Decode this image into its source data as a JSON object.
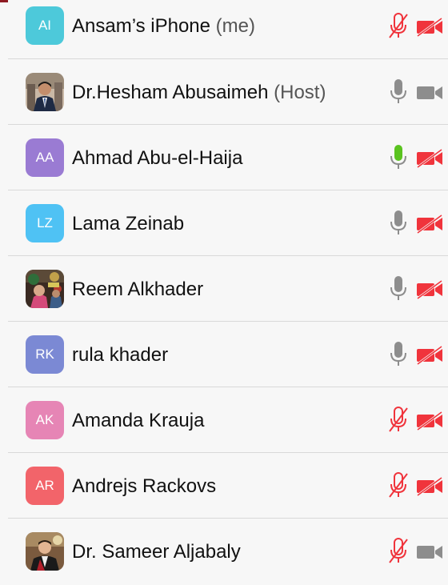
{
  "colors": {
    "muted_red": "#f0343c",
    "icon_gray": "#8d8d8d",
    "active_green": "#5ac31f"
  },
  "participants": [
    {
      "initials": "AI",
      "name": "Ansam’s iPhone",
      "tag": "(me)",
      "avatar_color": "#4dc9da",
      "mic": "muted",
      "video": "off"
    },
    {
      "initials": "",
      "name": "Dr.Hesham Abusaimeh",
      "tag": "(Host)",
      "avatar_color": "photo",
      "mic": "on",
      "video": "on"
    },
    {
      "initials": "AA",
      "name": "Ahmad Abu-el-Haija",
      "tag": "",
      "avatar_color": "#9a7bd3",
      "mic": "speaking",
      "video": "off"
    },
    {
      "initials": "LZ",
      "name": "Lama Zeinab",
      "tag": "",
      "avatar_color": "#4fc2f4",
      "mic": "on",
      "video": "off"
    },
    {
      "initials": "",
      "name": "Reem Alkhader",
      "tag": "",
      "avatar_color": "photo",
      "mic": "on",
      "video": "off"
    },
    {
      "initials": "RK",
      "name": "rula khader",
      "tag": "",
      "avatar_color": "#7b89d4",
      "mic": "on",
      "video": "off"
    },
    {
      "initials": "AK",
      "name": "Amanda Krauja",
      "tag": "",
      "avatar_color": "#e685b5",
      "mic": "muted",
      "video": "off"
    },
    {
      "initials": "AR",
      "name": "Andrejs Rackovs",
      "tag": "",
      "avatar_color": "#f2646a",
      "mic": "muted",
      "video": "off"
    },
    {
      "initials": "",
      "name": "Dr. Sameer Aljabaly",
      "tag": "",
      "avatar_color": "photo",
      "mic": "muted",
      "video": "on"
    }
  ]
}
